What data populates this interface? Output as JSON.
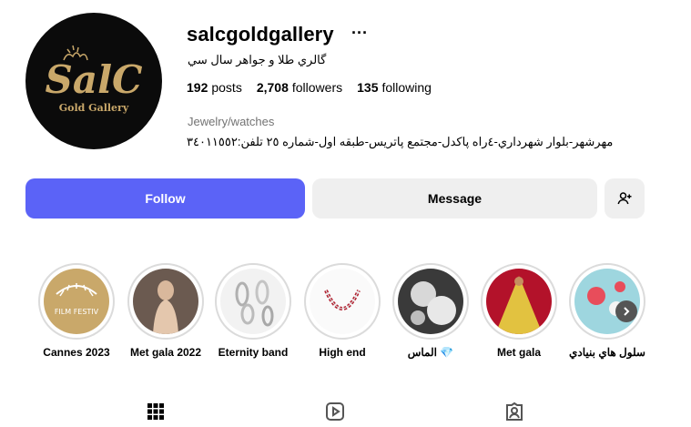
{
  "profile": {
    "username": "salcgoldgallery",
    "full_name": "گالري طلا و جواهر سال سي",
    "logo_text": "SalC",
    "logo_subtext": "Gold Gallery",
    "stats": {
      "posts_count": "192",
      "posts_label": "posts",
      "followers_count": "2,708",
      "followers_label": "followers",
      "following_count": "135",
      "following_label": "following"
    },
    "category": "Jewelry/watches",
    "bio": "مهرشهر-بلوار شهرداري-٤راه پاكدل-مجتمع پاتريس-طبقه اول-شماره ٢٥ تلفن:٣٤٠١١٥٥٢"
  },
  "actions": {
    "follow_label": "Follow",
    "message_label": "Message"
  },
  "highlights": [
    {
      "label": "Cannes 2023",
      "thumb_text": "FILM FESTIV"
    },
    {
      "label": "Met gala 2022"
    },
    {
      "label": "Eternity band"
    },
    {
      "label": "High end"
    },
    {
      "label": "الماس 💎"
    },
    {
      "label": "Met gala"
    },
    {
      "label": "سلول هاي بنيادي"
    }
  ],
  "tabs": [
    "grid-icon",
    "reels-icon",
    "tagged-icon"
  ],
  "colors": {
    "accent": "#5b63f7",
    "secondary_bg": "#efefef",
    "gold": "#c9a86a"
  }
}
